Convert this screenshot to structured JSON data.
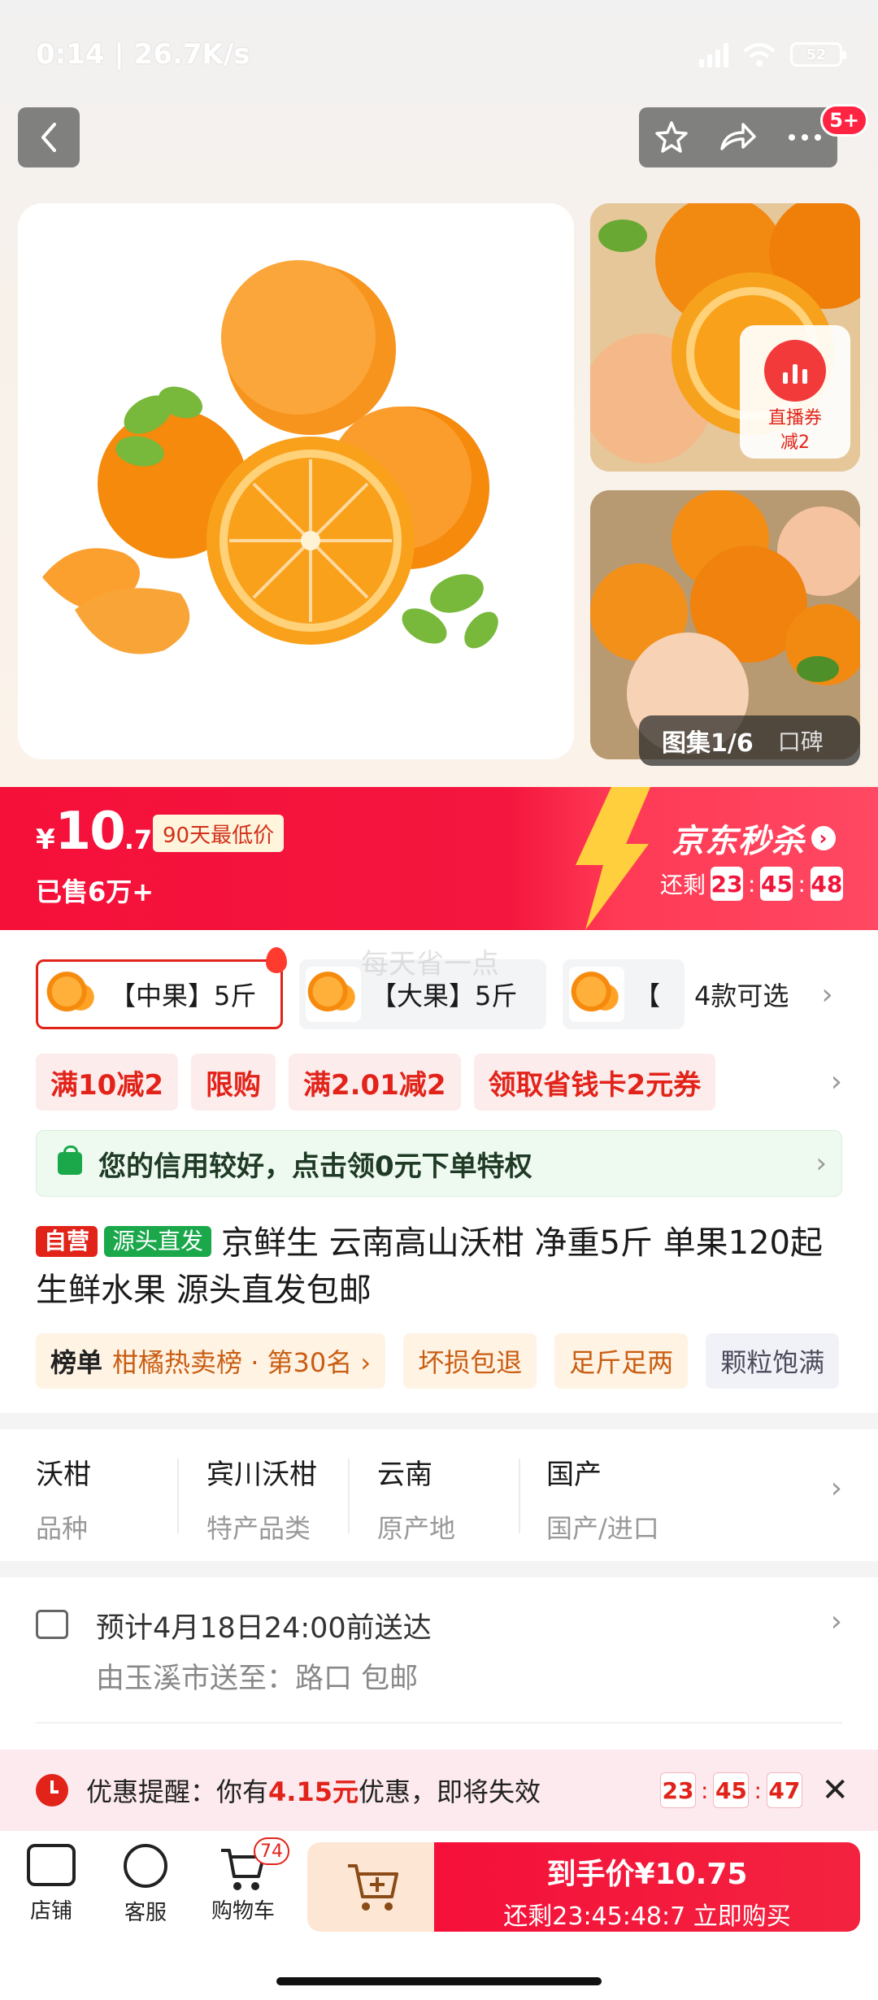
{
  "status_bar": {
    "time_speed": "0:14 | 26.7K/s",
    "battery": "52"
  },
  "nav": {
    "badge": "5+"
  },
  "gallery": {
    "live_coupon": [
      "直播券",
      "减2"
    ],
    "counter": "图集1/6",
    "reviews": "口碑"
  },
  "price": {
    "yen": "¥",
    "integer": "10",
    "decimal": ".75",
    "lowest_tag": "90天最低价",
    "sold": "已售6万+",
    "flash_label": "京东秒杀",
    "remain_label": "还剩",
    "cd_h": "23",
    "cd_m": "45",
    "cd_s": "48"
  },
  "variants": {
    "items": [
      "【中果】5斤",
      "【大果】5斤",
      "【"
    ],
    "more": "4款可选"
  },
  "watermark": "每天省一点",
  "promos": [
    "满10减2",
    "限购",
    "满2.01减2",
    "领取省钱卡2元券"
  ],
  "credit": "您的信用较好，点击领0元下单特权",
  "title": {
    "tag_self": "自营",
    "tag_source": "源头直发",
    "text": "京鲜生 云南高山沃柑 净重5斤 单果120起 生鲜水果 源头直发包邮"
  },
  "chips": {
    "rank_label": "榜单",
    "rank_text": "柑橘热卖榜 · 第30名 ›",
    "c2": "坏损包退",
    "c3": "足斤足两",
    "c4": "颗粒饱满"
  },
  "specs": [
    {
      "value": "沃柑",
      "key": "品种"
    },
    {
      "value": "宾川沃柑",
      "key": "特产品类"
    },
    {
      "value": "云南",
      "key": "原产地"
    },
    {
      "value": "国产",
      "key": "国产/进口"
    }
  ],
  "delivery": {
    "line1": "预计4月18日24:00前送达",
    "line2": "由玉溪市送至：路口  包邮"
  },
  "reminder": {
    "prefix": "优惠提醒：你有",
    "amount": "4.15元",
    "suffix": "优惠，即将失效",
    "cd_h": "23",
    "cd_m": "45",
    "cd_s": "47"
  },
  "bottom": {
    "shop": "店铺",
    "service": "客服",
    "cart": "购物车",
    "cart_count": "74",
    "buy_line1": "到手价¥10.75",
    "buy_line2": "还剩23:45:48:7  立即购买"
  },
  "colors": {
    "brand_red": "#f5103a",
    "green": "#1aa84b",
    "orange": "#f58a0c"
  }
}
